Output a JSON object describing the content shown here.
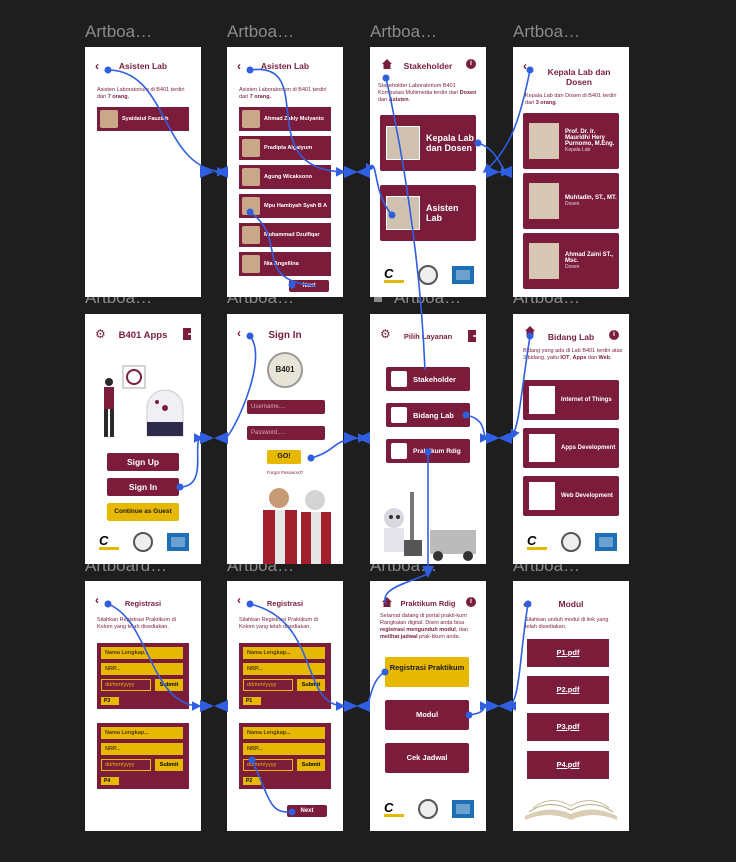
{
  "artboard_titles": [
    "Artboa…",
    "Artboa…",
    "Artboa…",
    "Artboa…",
    "Artboa…",
    "Artboa…",
    "Artboa…",
    "Artboa…",
    "Artboard…",
    "Artboa…",
    "Artboa…",
    "Artboa…"
  ],
  "asisten1": {
    "title": "Asisten Lab",
    "desc_pre": "Asisten Laboratorium di B401 terdiri dari ",
    "desc_bold": "7 orang.",
    "members": [
      "Syaidatul Fauziah"
    ]
  },
  "asisten2": {
    "title": "Asisten Lab",
    "desc_pre": "Asisten Laboratorium di B401 terdiri dari ",
    "desc_bold": "7 orang.",
    "members": [
      "Ahmad Zakiy Mulyanto",
      "Pradipta Algaiyum",
      "Agung Wicaksono",
      "Mpu Hambyah Syah B A",
      "Muhammad Dzulfiqar",
      "Nia Angellina"
    ],
    "next": "Next"
  },
  "stakeholder": {
    "title": "Stakeholder",
    "desc_pre": "Stakeholder Laboratorium B401 Komputasi Multimedia terdiri dari ",
    "desc_b1": "Dosen",
    "desc_mid": " dan ",
    "desc_b2": "Asisten",
    "desc_end": ".",
    "card1": "Kepala Lab dan Dosen",
    "card2": "Asisten Lab"
  },
  "kepala": {
    "title": "Kepala Lab dan Dosen",
    "desc_pre": "Kepala Lab dan Dosen di B401 terdiri dari ",
    "desc_bold": "3 orang",
    "desc_end": ".",
    "people": [
      {
        "name": "Prof. Dr. Ir. Mauridhi Hery Purnomo, M.Eng.",
        "role": "Kepala Lab"
      },
      {
        "name": "Muhtadin, ST., MT.",
        "role": "Dosen"
      },
      {
        "name": "Ahmad Zaini ST., Msc.",
        "role": "Dosen"
      }
    ]
  },
  "home": {
    "title": "B401 Apps",
    "signup": "Sign Up",
    "signin": "Sign In",
    "guest": "Continue as Guest"
  },
  "signin": {
    "title": "Sign In",
    "username": "Username....",
    "password": "Password.....",
    "go": "GO!",
    "forgot": "Forgot Password?",
    "logo_text": "B401"
  },
  "layanan": {
    "title": "Pilih Layanan",
    "items": [
      "Stakeholder",
      "Bidang Lab",
      "Praktikum Rdig"
    ]
  },
  "bidang": {
    "title": "Bidang Lab",
    "desc_pre": "Bidang yang ada di Lab B401 terdiri atas 3 bidang, yaitu ",
    "desc_b1": "IOT",
    "desc_c1": ", ",
    "desc_b2": "Apps",
    "desc_mid": " dan ",
    "desc_b3": "Web",
    "desc_end": ".",
    "items": [
      "Internet of Things",
      "Apps Development",
      "Web Development"
    ]
  },
  "reg1": {
    "title": "Registrasi",
    "desc": "Silahkan Registrasi Praktikum di Kolom yang telah disediakan.",
    "name_ph": "Nama Lengkap...",
    "nrp_ph": "NRP...",
    "date_ph": "dd/mm/yyyy",
    "submit": "Submit",
    "tags": [
      "P3",
      "P4"
    ]
  },
  "reg2": {
    "title": "Registrasi",
    "desc": "Silahkan Registrasi Praktikum di Kolom yang telah disediakan.",
    "name_ph": "Nama Lengkap...",
    "nrp_ph": "NRP...",
    "date_ph": "dd/mm/yyyy",
    "submit": "Submit",
    "tags": [
      "P1",
      "P2"
    ],
    "next": "Next"
  },
  "praktikum": {
    "title": "Praktikum Rdig",
    "desc_pre": "Selamat datang di portal prakti-kum Rangkaian digital. Disini anda bisa ",
    "desc_b1": "registrasi mengunduh modul",
    "desc_mid": ", dan ",
    "desc_b2": "melihat jadwal",
    "desc_end": " prak-tikum anda.",
    "reg": "Registrasi Praktikum",
    "modul": "Modul",
    "jadwal": "Cek Jadwal"
  },
  "modul": {
    "title": "Modul",
    "desc": "Silahkan unduh modul di link yang telah disediakan.",
    "files": [
      "P1.pdf",
      "P2.pdf",
      "P3.pdf",
      "P4.pdf"
    ]
  },
  "colors": {
    "maroon": "#7b1d3a",
    "yellow": "#e6b800",
    "link": "#2f5fe0",
    "canvas": "#1e1e1e"
  }
}
